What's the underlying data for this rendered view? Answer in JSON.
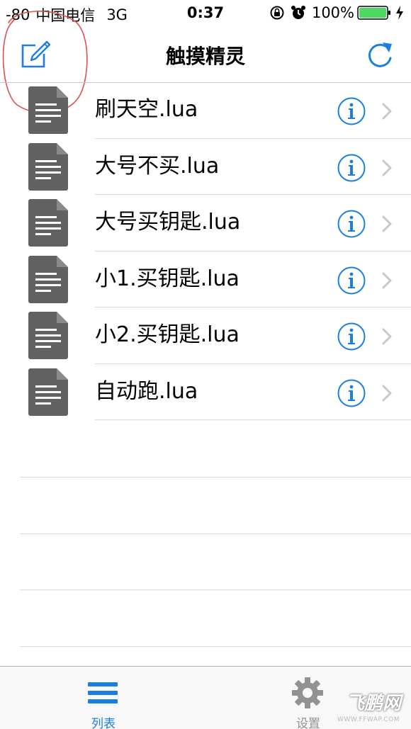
{
  "status_bar": {
    "signal": "-80",
    "carrier": "中国电信",
    "network": "3G",
    "time": "0:37",
    "battery": "100%"
  },
  "nav": {
    "title": "触摸精灵",
    "compose_icon": "compose-icon",
    "refresh_icon": "refresh-icon"
  },
  "files": [
    {
      "name": "刷天空.lua"
    },
    {
      "name": "大号不买.lua"
    },
    {
      "name": "大号买钥匙.lua"
    },
    {
      "name": "小1.买钥匙.lua"
    },
    {
      "name": "小2.买钥匙.lua"
    },
    {
      "name": "自动跑.lua"
    }
  ],
  "tabs": [
    {
      "label": "列表",
      "icon": "list-icon",
      "selected": true
    },
    {
      "label": "设置",
      "icon": "gear-icon",
      "selected": false
    }
  ],
  "watermark": {
    "text": "飞鹏网",
    "url": "WWW.FFWAP.COM"
  },
  "colors": {
    "accent": "#1a7fe0",
    "battery": "#4cd964",
    "doc_icon": "#616161",
    "annotation": "#d9534f",
    "tab_inactive": "#929292"
  }
}
